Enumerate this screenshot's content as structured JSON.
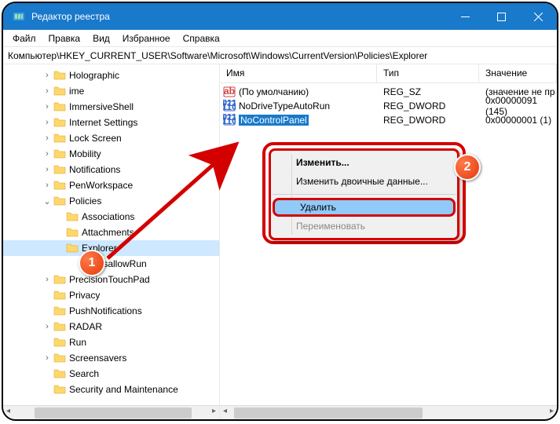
{
  "window": {
    "title": "Редактор реестра"
  },
  "menu": [
    "Файл",
    "Правка",
    "Вид",
    "Избранное",
    "Справка"
  ],
  "address": "Компьютер\\HKEY_CURRENT_USER\\Software\\Microsoft\\Windows\\CurrentVersion\\Policies\\Explorer",
  "tree": [
    {
      "label": "Holographic",
      "depth": 3,
      "exp": "›"
    },
    {
      "label": "ime",
      "depth": 3,
      "exp": "›"
    },
    {
      "label": "ImmersiveShell",
      "depth": 3,
      "exp": "›"
    },
    {
      "label": "Internet Settings",
      "depth": 3,
      "exp": "›"
    },
    {
      "label": "Lock Screen",
      "depth": 3,
      "exp": "›"
    },
    {
      "label": "Mobility",
      "depth": 3,
      "exp": "›"
    },
    {
      "label": "Notifications",
      "depth": 3,
      "exp": "›"
    },
    {
      "label": "PenWorkspace",
      "depth": 3,
      "exp": "›"
    },
    {
      "label": "Policies",
      "depth": 3,
      "exp": "⌄"
    },
    {
      "label": "Associations",
      "depth": 4,
      "exp": ""
    },
    {
      "label": "Attachments",
      "depth": 4,
      "exp": ""
    },
    {
      "label": "Explorer",
      "depth": 4,
      "exp": "",
      "sel": true
    },
    {
      "label": "DisallowRun",
      "depth": 5,
      "exp": ""
    },
    {
      "label": "PrecisionTouchPad",
      "depth": 3,
      "exp": "›"
    },
    {
      "label": "Privacy",
      "depth": 3,
      "exp": ""
    },
    {
      "label": "PushNotifications",
      "depth": 3,
      "exp": ""
    },
    {
      "label": "RADAR",
      "depth": 3,
      "exp": "›"
    },
    {
      "label": "Run",
      "depth": 3,
      "exp": ""
    },
    {
      "label": "Screensavers",
      "depth": 3,
      "exp": "›"
    },
    {
      "label": "Search",
      "depth": 3,
      "exp": ""
    },
    {
      "label": "Security and Maintenance",
      "depth": 3,
      "exp": ""
    }
  ],
  "cols": {
    "name": "Имя",
    "type": "Тип",
    "value": "Значение"
  },
  "rows": [
    {
      "icon": "sz",
      "name": "(По умолчанию)",
      "type": "REG_SZ",
      "value": "(значение не пр"
    },
    {
      "icon": "dw",
      "name": "NoDriveTypeAutoRun",
      "type": "REG_DWORD",
      "value": "0x00000091 (145)"
    },
    {
      "icon": "dw",
      "name": "NoControlPanel",
      "type": "REG_DWORD",
      "value": "0x00000001 (1)",
      "sel": true
    }
  ],
  "ctx": {
    "modify": "Изменить...",
    "modbin": "Изменить двоичные данные...",
    "delete": "Удалить",
    "rename": "Переименовать"
  },
  "badges": {
    "b1": "1",
    "b2": "2"
  }
}
